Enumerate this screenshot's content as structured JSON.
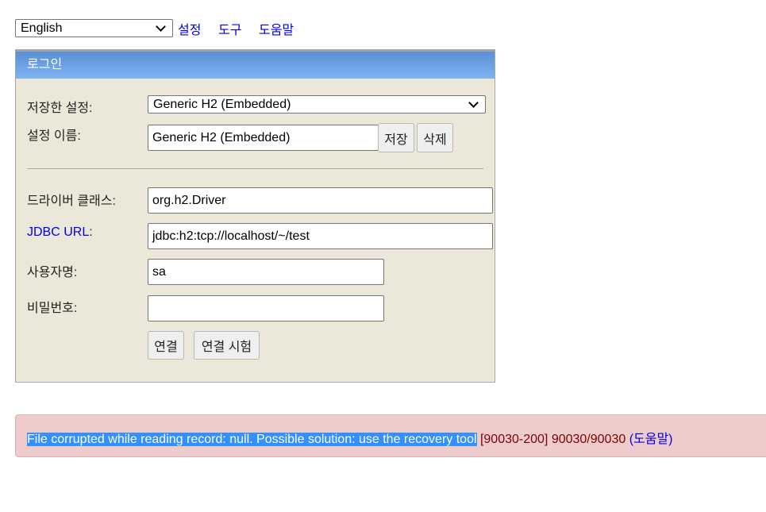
{
  "top": {
    "language": "English",
    "links": [
      "설정",
      "도구",
      "도움말"
    ]
  },
  "login": {
    "title": "로그인",
    "saved_settings_label": "저장한 설정:",
    "saved_settings_value": "Generic H2 (Embedded)",
    "setting_name_label": "설정 이름:",
    "setting_name_value": "Generic H2 (Embedded)",
    "save_button": "저장",
    "delete_button": "삭제",
    "driver_label": "드라이버 클래스:",
    "driver_value": "org.h2.Driver",
    "jdbc_label": "JDBC URL",
    "jdbc_colon": ":",
    "jdbc_value": "jdbc:h2:tcp://localhost/~/test",
    "user_label": "사용자명:",
    "user_value": "sa",
    "password_label": "비밀번호:",
    "password_value": "",
    "connect_button": "연결",
    "test_button": "연결 시험"
  },
  "error": {
    "message": "File corrupted while reading record: null. Possible solution: use the recovery tool",
    "code": " [90030-200] 90030/90030 ",
    "help_link": "(도움말)"
  }
}
